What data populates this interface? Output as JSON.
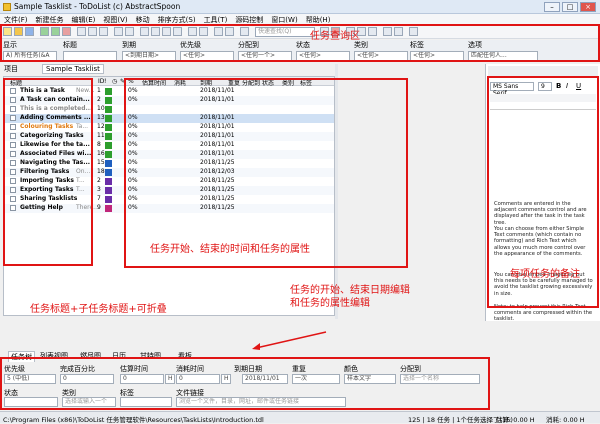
{
  "window": {
    "title": "Sample Tasklist - ToDoList (c) AbstractSpoon"
  },
  "menu": [
    "文件(F)",
    "新建任务",
    "编辑(E)",
    "视图(V)",
    "移动",
    "排序方式(S)",
    "工具(T)",
    "源码控制",
    "窗口(W)",
    "帮助(H)"
  ],
  "toolbar": {
    "search_placeholder": "快速查找(Q)"
  },
  "filter": {
    "headers": [
      "显示",
      "标题",
      "到期",
      "优先级",
      "分配到",
      "状态",
      "类别",
      "标签",
      "选项"
    ],
    "values": [
      "A) 所有任务(&A",
      "",
      "<到期日期>",
      "<任何>",
      "<任何一个>",
      "<任何>",
      "<任何>",
      "<任何>",
      "匹配任何人..."
    ]
  },
  "tabs": {
    "project": "项目",
    "current": "Sample Tasklist"
  },
  "table": {
    "headers": [
      "标题",
      "ID",
      "!",
      "◷",
      "✎",
      "%",
      "估算时间",
      "消耗",
      "到期",
      "重复",
      "分配到",
      "状态",
      "类别",
      "标签"
    ],
    "rows": [
      {
        "title": "This is a Task",
        "subtitle": "New...",
        "id": "1",
        "pri": "",
        "pct": "0%",
        "due": "2018/11/01",
        "pricolor": "#2d9e2d"
      },
      {
        "title": "A Task can contain...",
        "subtitle": "",
        "id": "2",
        "pri": "",
        "pct": "0%",
        "due": "2018/11/01",
        "pricolor": "#2d9e2d"
      },
      {
        "title": "This is a completed...",
        "subtitle": "",
        "id": "10",
        "pri": "",
        "pct": "",
        "due": "",
        "pricolor": "#2d9e2d"
      },
      {
        "title": "Adding Comments ...",
        "subtitle": "",
        "id": "13",
        "pri": "",
        "pct": "0%",
        "due": "2018/11/01",
        "pricolor": "#2d9e2d"
      },
      {
        "title": "Colouring Tasks",
        "subtitle": "Ta...",
        "id": "12",
        "pri": "",
        "pct": "0%",
        "due": "2018/11/01",
        "pricolor": "#2d9e2d"
      },
      {
        "title": "Categorizing Tasks",
        "subtitle": "",
        "id": "11",
        "pri": "",
        "pct": "0%",
        "due": "2018/11/01",
        "pricolor": "#2d9e2d"
      },
      {
        "title": "Likewise for the ta...",
        "subtitle": "",
        "id": "8",
        "pri": "",
        "pct": "0%",
        "due": "2018/11/01",
        "pricolor": "#2d9e2d"
      },
      {
        "title": "Associated Files wi...",
        "subtitle": "",
        "id": "16",
        "pri": "",
        "pct": "0%",
        "due": "2018/11/01",
        "pricolor": "#2d9e2d"
      },
      {
        "title": "Navigating the Tas...",
        "subtitle": "",
        "id": "15",
        "pri": "",
        "pct": "0%",
        "due": "2018/11/25",
        "pricolor": "#1f5fbf"
      },
      {
        "title": "Filtering Tasks",
        "subtitle": "On...",
        "id": "18",
        "pri": "",
        "pct": "0%",
        "due": "2018/12/03",
        "pricolor": "#1f5fbf"
      },
      {
        "title": "Importing Tasks",
        "subtitle": "T...",
        "id": "2",
        "pri": "",
        "pct": "0%",
        "due": "2018/11/25",
        "pricolor": "#6a2da8"
      },
      {
        "title": "Exporting Tasks",
        "subtitle": "T...",
        "id": "3",
        "pri": "",
        "pct": "0%",
        "due": "2018/11/25",
        "pricolor": "#6a2da8"
      },
      {
        "title": "Sharing Tasklists",
        "subtitle": "",
        "id": "7",
        "pri": "",
        "pct": "0%",
        "due": "2018/11/25",
        "pricolor": "#6a2da8"
      },
      {
        "title": "Getting Help",
        "subtitle": "There...",
        "id": "9",
        "pri": "",
        "pct": "0%",
        "due": "2018/11/25",
        "pricolor": "#c0267a"
      }
    ]
  },
  "notes": {
    "font": "MS Sans Serif",
    "size": "9",
    "paragraphs": [
      "Comments are entered in the adjacent comments control and are displayed after the task in the task tree.",
      "You can choose from either Simple Text comments (which contain no formatting) and Rich Text which allows you much more control over the appearance of the comments.",
      "You can also embed images eg but this needs to be carefully managed to avoid the tasklist growing excessively in size.",
      "Note: to help prevent this Rich Text comments are compressed within the tasklist."
    ]
  },
  "bottom_tabs": [
    "任务树",
    "列表视图",
    "燃尽图",
    "日历",
    "甘特图",
    "看板"
  ],
  "edit": {
    "labels": [
      "优先级",
      "完成百分比",
      "估算时间",
      "消耗时间",
      "到期日期",
      "重复",
      "颜色",
      "分配到",
      "状态",
      "类别",
      "标签",
      "文件链接"
    ],
    "priority": "5 (中低)",
    "percent": "0",
    "est": "0",
    "spent": "0",
    "unit_est": "H",
    "unit_spent": "H",
    "due": "2018/11/01",
    "repeat": "一次",
    "color_value": "样本文字",
    "assign": "选择一个名称",
    "status": "",
    "category": "选择或输入一个",
    "tag": "",
    "filelink": "浏览一个文件，目录，网址，邮件或任务链接"
  },
  "status": {
    "path": "C:\\Program Files (x86)\\ToDoList 任务管理软件\\Resources\\TaskLists\\Introduction.tdl",
    "counts": "125 | 18 任务 | 1个任务选择了(15)",
    "est": "估算: 0.00 H",
    "spent": "消耗: 0.00 H"
  },
  "annotations": {
    "query": "任务查询区",
    "attributes": "任务开始、结束的时间和任务的属性",
    "titles": "任务标题+子任务标题+可折叠",
    "editing": "任务的开始、结束日期编辑\n和任务的属性编辑",
    "notes": "每项任务的备注"
  },
  "colors": {
    "annotation": "#e01414",
    "selected_row": "#cfe0f4"
  }
}
